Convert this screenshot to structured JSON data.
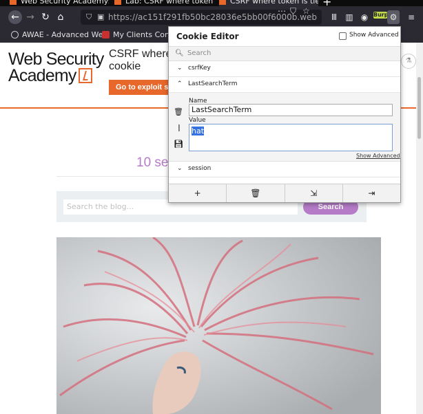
{
  "tabs": [
    {
      "label": "Web Security Academy: ",
      "close": "✕"
    },
    {
      "label": "Lab: CSRF where token is",
      "close": "✕"
    },
    {
      "label": "CSRF where token is tied",
      "close": "✕"
    }
  ],
  "new_tab": "+",
  "url": "https://ac151f291fb50bc28036e5bb00f6000b.web",
  "toolbar": {
    "burp_label": "Burp"
  },
  "bookmarks": [
    {
      "label": "AWAE - Advanced We..."
    },
    {
      "label": "My Clients Control"
    }
  ],
  "page": {
    "logo_line1": "Web Security",
    "logo_line2": "Academy",
    "lab_title_line1": "CSRF where",
    "lab_title_line2": "cookie",
    "exploit_button": "Go to exploit s",
    "blog_heading": "10 se",
    "search_placeholder": "Search the blog...",
    "search_button": "Search"
  },
  "cookie_editor": {
    "title": "Cookie Editor",
    "show_advanced_label": "Show Advanced",
    "search_placeholder": "Search",
    "cookies": [
      {
        "name": "csrfKey",
        "expanded": false
      },
      {
        "name": "LastSearchTerm",
        "expanded": true
      },
      {
        "name": "session",
        "expanded": false
      }
    ],
    "name_label": "Name",
    "name_value": "LastSearchTerm",
    "value_label": "Value",
    "value_value": "hat",
    "show_advanced_link": "Show Advanced"
  },
  "colors": {
    "accent_orange": "#e8672a",
    "accent_purple": "#b57bc7",
    "browser_dark": "#2b2a33"
  }
}
